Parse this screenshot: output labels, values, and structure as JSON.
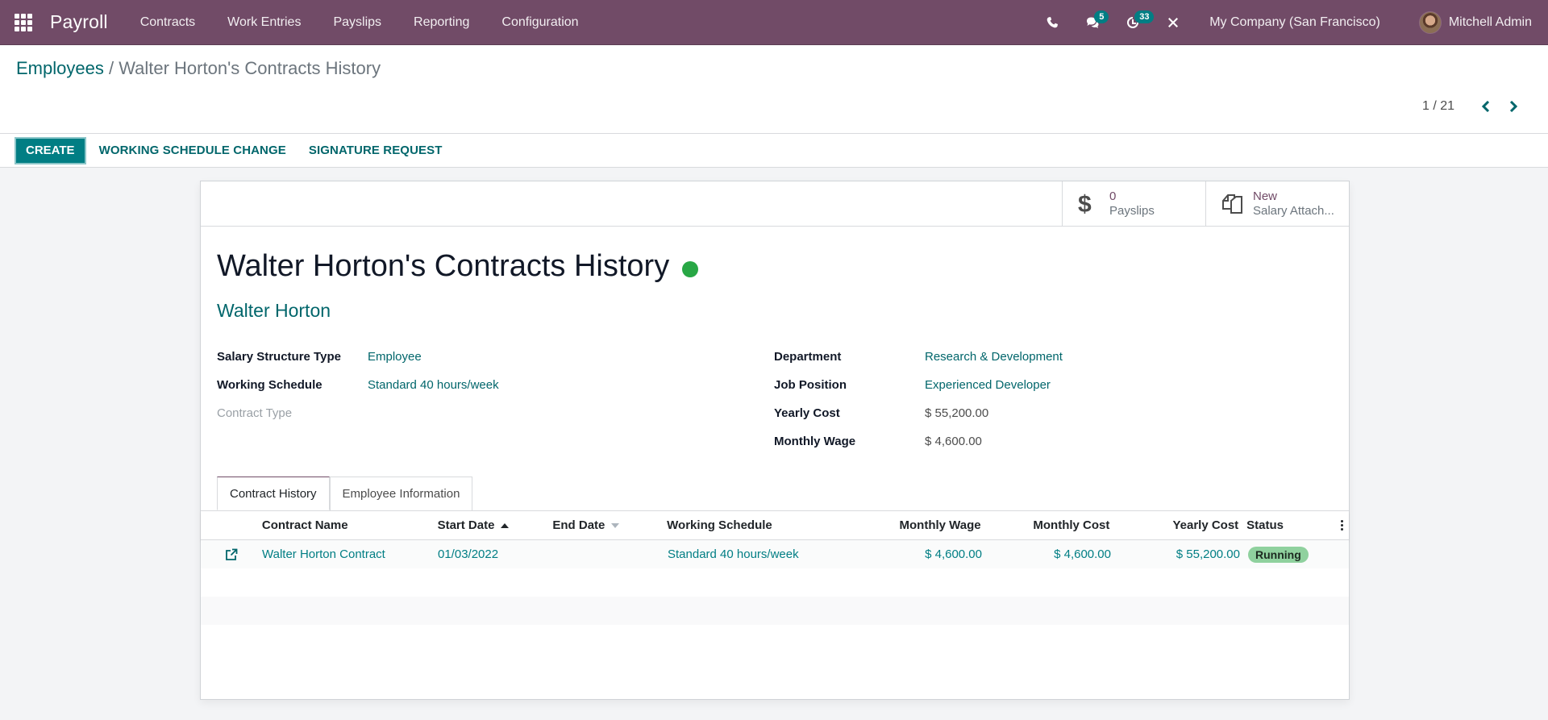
{
  "navbar": {
    "app_name": "Payroll",
    "menu": [
      {
        "label": "Contracts"
      },
      {
        "label": "Work Entries"
      },
      {
        "label": "Payslips"
      },
      {
        "label": "Reporting"
      },
      {
        "label": "Configuration"
      }
    ],
    "icons": [
      "phone-icon",
      "chat-icon",
      "activity-clock-icon",
      "debug-tools-icon"
    ],
    "messages_count": "5",
    "activities_count": "33",
    "company": "My Company (San Francisco)",
    "user": "Mitchell Admin"
  },
  "breadcrumb": {
    "parent": "Employees",
    "separator": " / ",
    "current": "Walter Horton's Contracts History"
  },
  "pager": {
    "value": "1 / 21"
  },
  "actions": {
    "create": "CREATE",
    "working_schedule_change": "WORKING SCHEDULE CHANGE",
    "signature_request": "SIGNATURE REQUEST"
  },
  "stat_buttons": [
    {
      "icon": "dollar-icon",
      "value": "0",
      "label": "Payslips"
    },
    {
      "icon": "documents-icon",
      "value": "New",
      "label": "Salary Attach..."
    }
  ],
  "record": {
    "title": "Walter Horton's Contracts History",
    "status_color": "#28a745",
    "employee": "Walter Horton",
    "left_fields": [
      {
        "label": "Salary Structure Type",
        "value": "Employee"
      },
      {
        "label": "Working Schedule",
        "value": "Standard 40 hours/week"
      },
      {
        "label": "Contract Type",
        "value": ""
      }
    ],
    "right_fields": [
      {
        "label": "Department",
        "value": "Research & Development"
      },
      {
        "label": "Job Position",
        "value": "Experienced Developer"
      },
      {
        "label": "Yearly Cost",
        "value": "$ 55,200.00"
      },
      {
        "label": "Monthly Wage",
        "value": "$ 4,600.00"
      }
    ]
  },
  "tabs": [
    {
      "label": "Contract History",
      "active": true
    },
    {
      "label": "Employee Information",
      "active": false
    }
  ],
  "table": {
    "columns": [
      "Contract Name",
      "Start Date",
      "End Date",
      "Working Schedule",
      "Monthly Wage",
      "Monthly Cost",
      "Yearly Cost",
      "Status"
    ],
    "rows": [
      {
        "contract_name": "Walter Horton Contract",
        "start_date": "01/03/2022",
        "end_date": "",
        "working_schedule": "Standard 40 hours/week",
        "monthly_wage": "$ 4,600.00",
        "monthly_cost": "$ 4,600.00",
        "yearly_cost": "$ 55,200.00",
        "status": "Running"
      }
    ]
  },
  "colors": {
    "navbar": "#714b67",
    "primary": "#017e84",
    "link": "#01666b",
    "status_running": "#8fd19e"
  }
}
